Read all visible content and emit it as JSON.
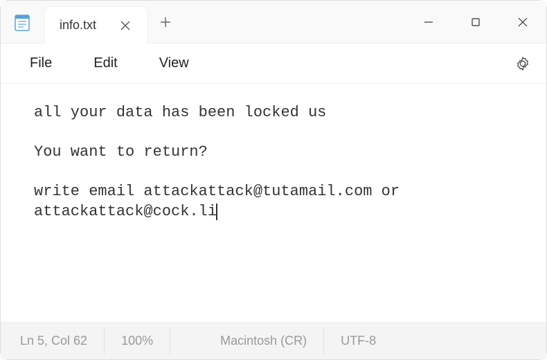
{
  "tab": {
    "title": "info.txt"
  },
  "menu": {
    "file": "File",
    "edit": "Edit",
    "view": "View"
  },
  "content": {
    "text": "all your data has been locked us\n\nYou want to return?\n\nwrite email attackattack@tutamail.com or attackattack@cock.li"
  },
  "status": {
    "cursor": "Ln 5, Col 62",
    "zoom": "100%",
    "line_ending": "Macintosh (CR)",
    "encoding": "UTF-8"
  }
}
